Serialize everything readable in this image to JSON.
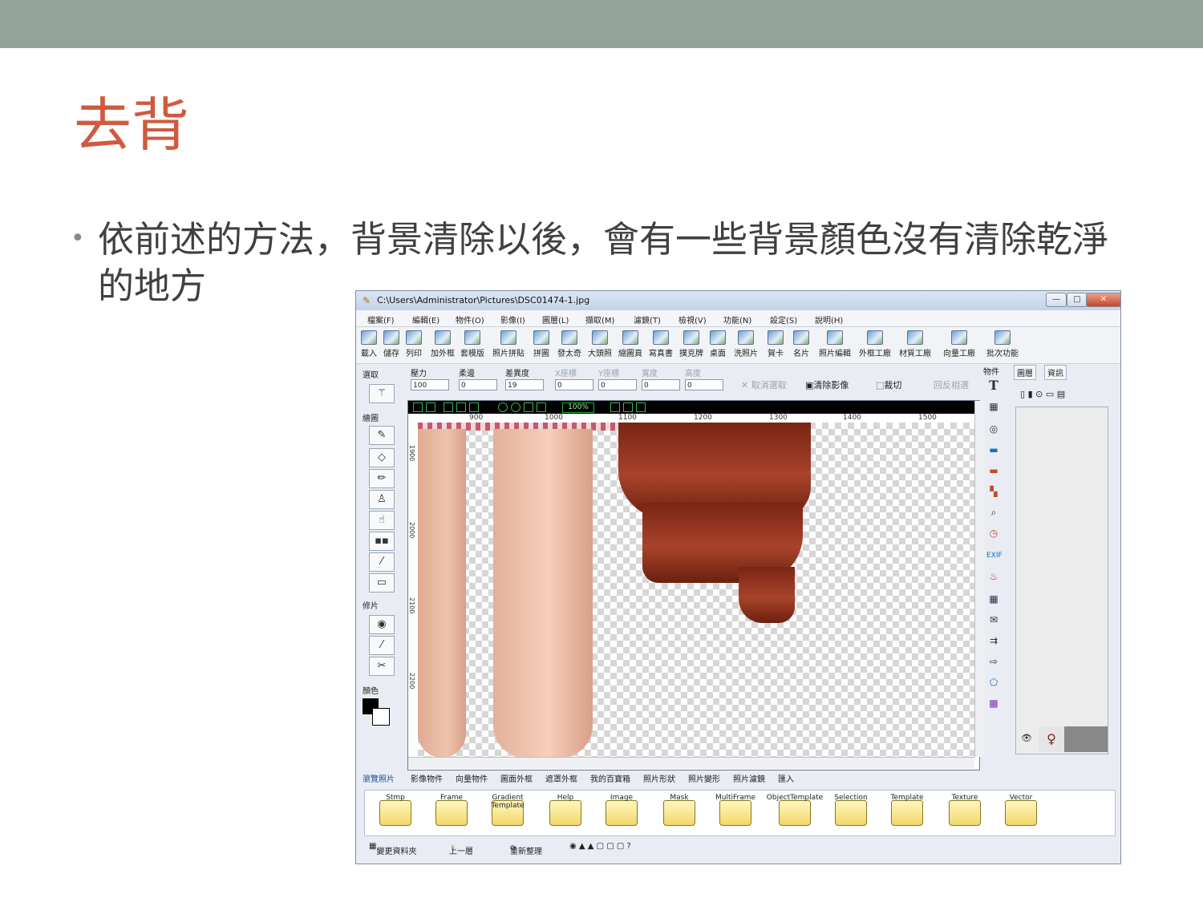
{
  "slide": {
    "title": "去背",
    "bullet": "依前述的方法，背景清除以後，會有一些背景顏色沒有清除乾淨的地方"
  },
  "window": {
    "title": "C:\\Users\\Administrator\\Pictures\\DSC01474-1.jpg",
    "controls": {
      "minimize": "—",
      "maximize": "□",
      "close": "✕"
    }
  },
  "menu": [
    "檔案(F)",
    "編輯(E)",
    "物件(O)",
    "影像(I)",
    "圖層(L)",
    "擷取(M)",
    "濾鏡(T)",
    "檢視(V)",
    "功能(N)",
    "設定(S)",
    "說明(H)"
  ],
  "toolbar": [
    "載入",
    "儲存",
    "列印",
    "加外框",
    "套模版",
    "照片拼貼",
    "拼圖",
    "發太奇",
    "大頭照",
    "縮圖頁",
    "寫真書",
    "撲克牌",
    "桌面",
    "洗照片",
    "賀卡",
    "名片",
    "照片編輯",
    "外框工廠",
    "材質工廠",
    "向量工廠",
    "批次功能"
  ],
  "left_panel": {
    "select_label": "選取",
    "draw_label": "繪圖",
    "retouch_label": "修片",
    "color_label": "顏色"
  },
  "options": {
    "pressure_label": "壓力",
    "pressure_value": "100",
    "feather_label": "柔邊",
    "feather_value": "0",
    "tolerance_label": "差異度",
    "tolerance_value": "19",
    "x_label": "X座標",
    "x_value": "0",
    "y_label": "Y座標",
    "y_value": "0",
    "width_label": "寬度",
    "width_value": "0",
    "height_label": "高度",
    "height_value": "0",
    "cancel_select": "取消選取",
    "clear_image": "清除影像",
    "crop": "裁切",
    "invert": "回反相選"
  },
  "view": {
    "zoom": "100%"
  },
  "ruler_h": [
    "900",
    "1000",
    "1100",
    "1200",
    "1300",
    "1400",
    "1500"
  ],
  "ruler_v": [
    "1900",
    "2000",
    "2100",
    "2200"
  ],
  "right_strip": {
    "label": "物件"
  },
  "layer_panel": {
    "tabs": [
      "圖層",
      "資訊"
    ]
  },
  "bottom_tabs": [
    "瀏覽照片",
    "影像物件",
    "向量物件",
    "圖面外框",
    "遮罩外框",
    "我的百寶箱",
    "照片形狀",
    "照片變形",
    "照片濾鏡",
    "匯入"
  ],
  "folders": [
    "Stmp",
    "Frame",
    "Gradient Template",
    "Help",
    "Image",
    "Mask",
    "MultiFrame",
    "ObjectTemplate",
    "Selection",
    "Template",
    "Texture",
    "Vector"
  ],
  "statusbar": {
    "change_folder": "變更資料夾",
    "up": "上一層",
    "refresh": "重新整理"
  }
}
